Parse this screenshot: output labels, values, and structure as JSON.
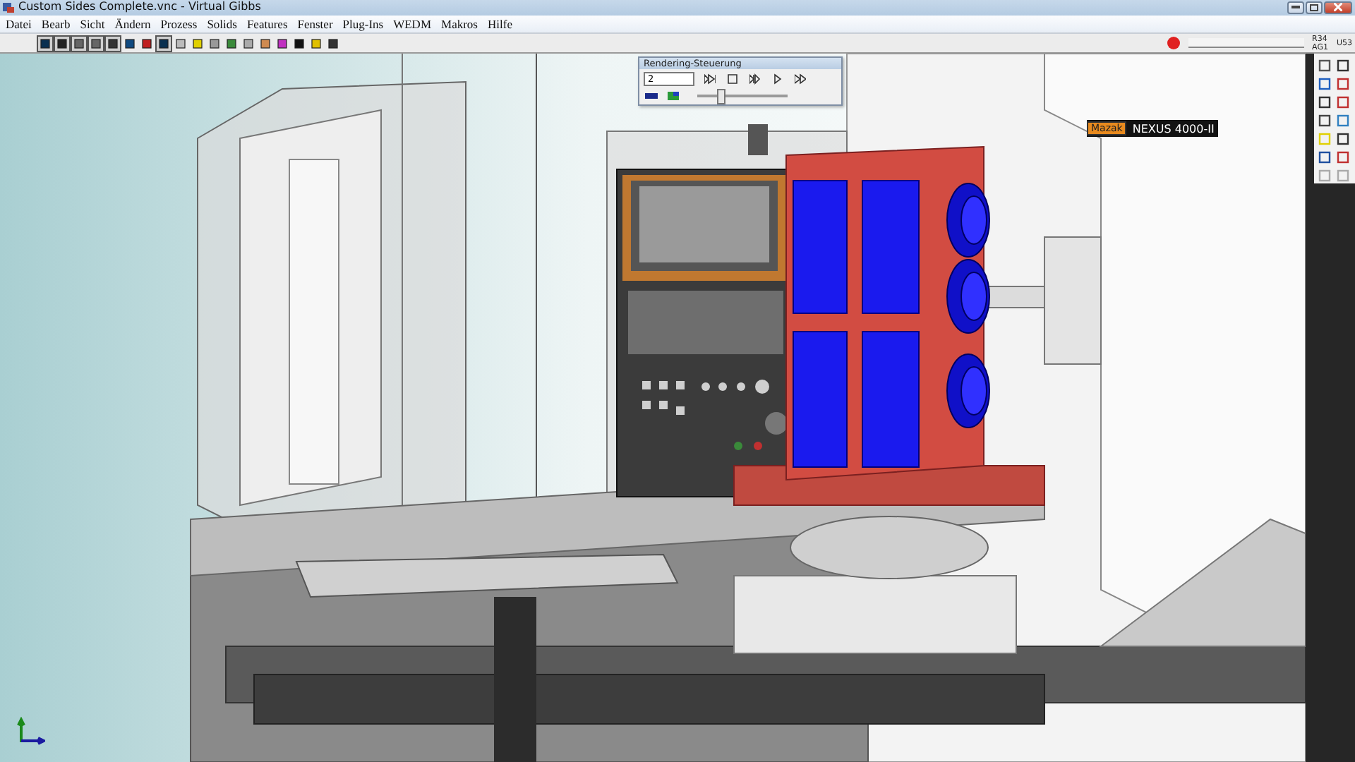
{
  "window": {
    "title": "Custom Sides Complete.vnc - Virtual Gibbs"
  },
  "menu": [
    "Datei",
    "Bearb",
    "Sicht",
    "Ändern",
    "Prozess",
    "Solids",
    "Features",
    "Fenster",
    "Plug-Ins",
    "WEDM",
    "Makros",
    "Hilfe"
  ],
  "toolbar": {
    "progress": {
      "level": 0
    },
    "readouts": [
      "R34",
      "AG1",
      "U53"
    ]
  },
  "render_panel": {
    "title": "Rendering-Steuerung",
    "frame": "2",
    "slider": {
      "level": 0.25
    }
  },
  "machine_label": {
    "brand": "Mazak",
    "model": "NEXUS 4000-II"
  }
}
